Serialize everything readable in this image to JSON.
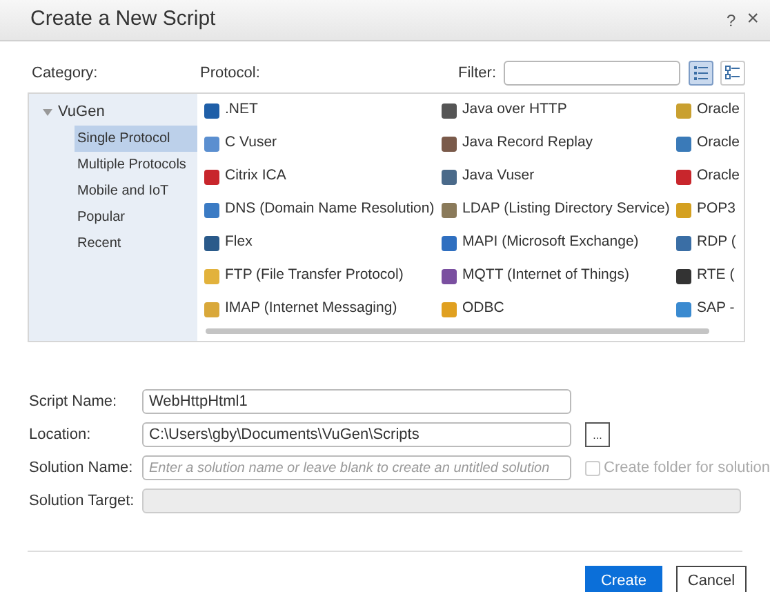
{
  "window": {
    "title": "Create a New Script",
    "help": "?",
    "close": "×"
  },
  "category": {
    "label": "Category:",
    "tree": [
      {
        "label": "VuGen",
        "expanded": true,
        "selected": false,
        "children": [
          {
            "label": "Single Protocol",
            "selected": true
          },
          {
            "label": "Multiple Protocols",
            "selected": false
          },
          {
            "label": "Mobile and IoT",
            "selected": false
          },
          {
            "label": "Popular",
            "selected": false
          },
          {
            "label": "Recent",
            "selected": false
          }
        ]
      }
    ]
  },
  "protocol": {
    "label": "Protocol:",
    "filter_label": "Filter:",
    "view_modes": [
      {
        "selected": true
      },
      {
        "selected": false
      }
    ],
    "items": [
      {
        "label": ".NET"
      },
      {
        "label": "C Vuser"
      },
      {
        "label": "Citrix ICA"
      },
      {
        "label": "DNS (Domain Name Resolution)"
      },
      {
        "label": "Flex"
      },
      {
        "label": "FTP (File Transfer Protocol)"
      },
      {
        "label": "IMAP (Internet Messaging)"
      },
      {
        "label": "Java over HTTP"
      },
      {
        "label": "Java Record Replay"
      },
      {
        "label": "Java Vuser"
      },
      {
        "label": "LDAP (Listing Directory Service)"
      },
      {
        "label": "MAPI (Microsoft Exchange)"
      },
      {
        "label": "MQTT (Internet of Things)"
      },
      {
        "label": "ODBC"
      },
      {
        "label": "Oracle"
      },
      {
        "label": "Oracle"
      },
      {
        "label": "Oracle"
      },
      {
        "label": "POP3"
      },
      {
        "label": "RDP ("
      },
      {
        "label": "RTE ("
      },
      {
        "label": "SAP -"
      }
    ]
  },
  "form": {
    "script_name": {
      "label": "Script Name:",
      "value": "WebHttpHtml1"
    },
    "location": {
      "label": "Location:",
      "value": "C:\\Users\\gby\\Documents\\VuGen\\Scripts",
      "browse": "..."
    },
    "solution_name": {
      "label": "Solution Name:",
      "placeholder": "Enter a solution name or leave blank to create an untitled solution"
    },
    "create_folder": {
      "label": "Create folder for solution",
      "checked": false,
      "disabled": true
    },
    "solution_target": {
      "label": "Solution Target:",
      "disabled": true
    }
  },
  "buttons": [
    {
      "label": "Create",
      "primary": true
    },
    {
      "label": "Cancel",
      "primary": false
    }
  ]
}
